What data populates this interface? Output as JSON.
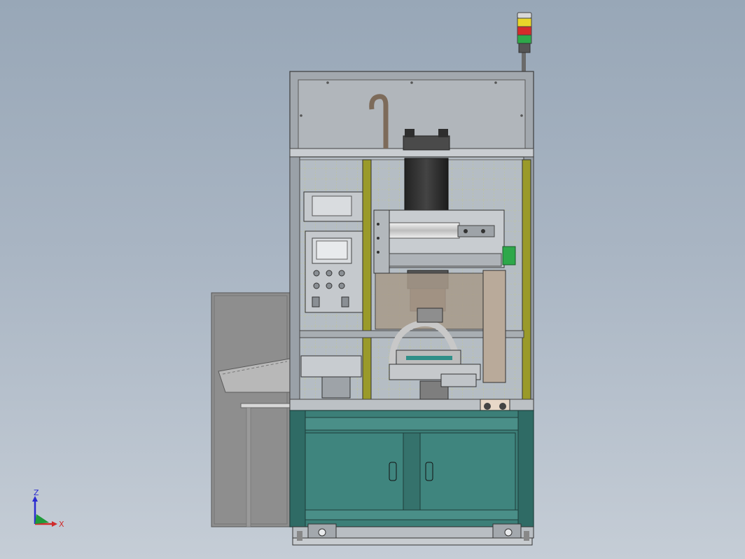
{
  "viewport": {
    "background_top": "#98a7b7",
    "background_bottom": "#c5cdd6"
  },
  "triad": {
    "z_label": "Z",
    "x_label": "X",
    "z_color": "#2b2bd0",
    "x_color": "#d02b2b",
    "y_color": "#1f9a3a"
  },
  "machine": {
    "frame_color": "#8b949c",
    "cabinet_color": "#3c7f78",
    "upright_color": "#9a9a2a",
    "tower_light": [
      "yellow",
      "red",
      "green"
    ]
  }
}
